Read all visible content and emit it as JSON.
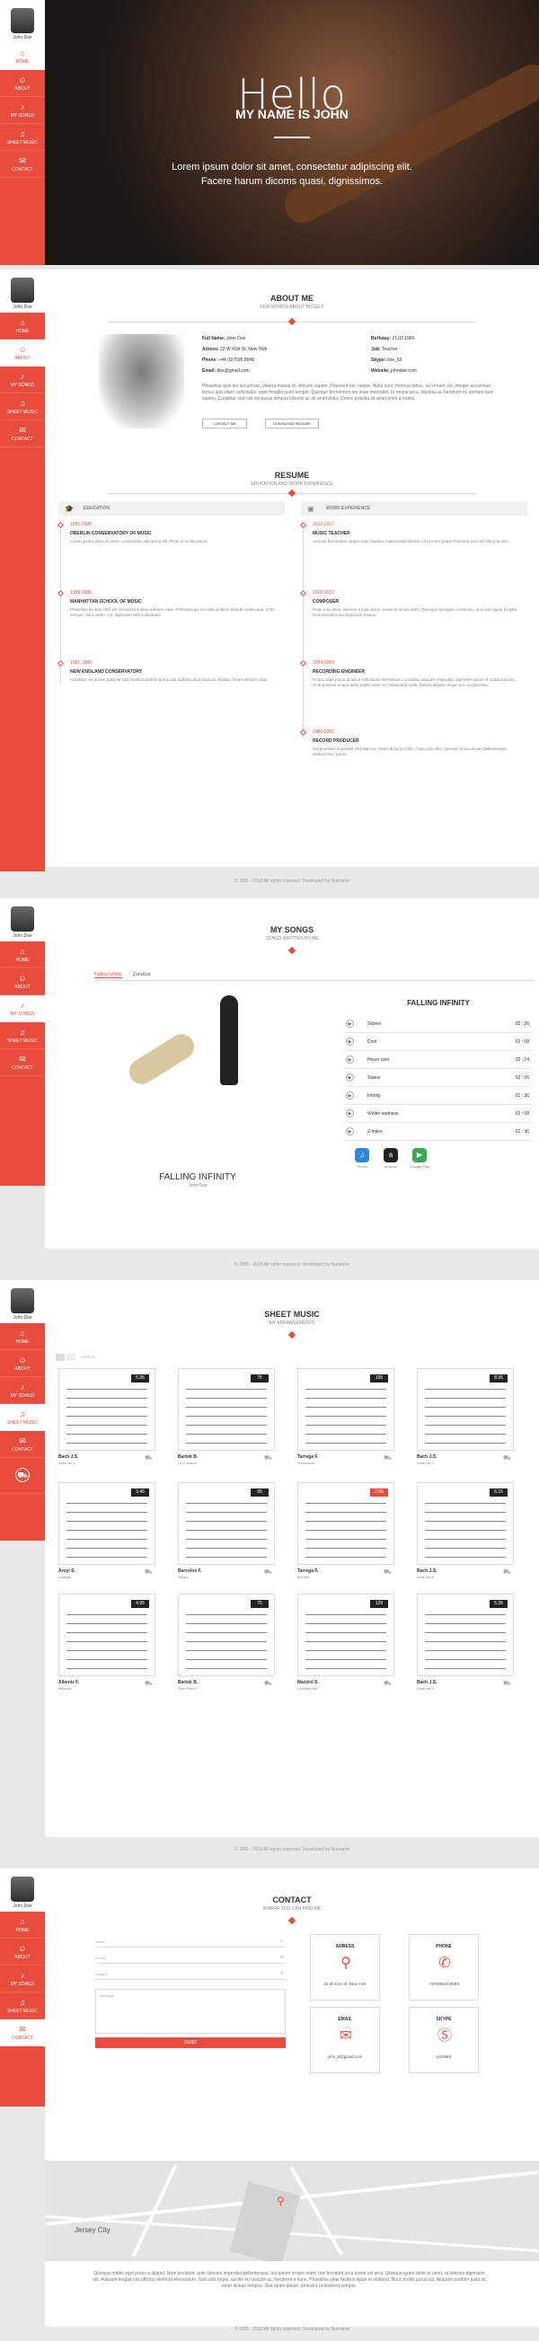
{
  "nav": {
    "name": "John Doe",
    "items": [
      "HOME",
      "ABOUT",
      "MY SONGS",
      "SHEET MUSIC",
      "CONTACT"
    ]
  },
  "hero": {
    "title": "Hello",
    "subtitle": "MY NAME IS JOHN",
    "text": "Lorem ipsum dolor sit amet, consectetur adipiscing elit. Facere harum dicoms quasi, dignissimos."
  },
  "about": {
    "title": "ABOUT ME",
    "subtitle": "FEW WORDS ABOUT MYSELF",
    "fields": [
      [
        "Full Name:",
        "John Doe"
      ],
      [
        "Adress:",
        "22 W 41st St, New York"
      ],
      [
        "Phone:",
        "+44 (0)7595 8948"
      ],
      [
        "Email:",
        "doe@gmail.com"
      ]
    ],
    "fields2": [
      [
        "Birthday:",
        "21.02.1966"
      ],
      [
        "Job:",
        "Teacher"
      ],
      [
        "Skype:",
        "doe_65"
      ],
      [
        "Website:",
        "johndoe.com"
      ]
    ],
    "bio": "Phasellus quis leo accumsan, viverra massa id, ultricies sapien. Praesent nec neque. Nulla nunc rhoncus tellus, vel ornare vel. Integer accumsan lectus quis diam sollicitudin, eget fringilla justo tempor. Quisque fermentum leo vitae imperdiet. In neque arcu, dapibus ac hendrerit id, pretium quis sapien. Curabitur sed nisi vel purus tempus lobortis ac sit amet dolor. Donec gravida sit amet enim a mattis.",
    "btn1": "CONTACT ME",
    "btn2": "DOWNLOAD RESUME"
  },
  "resume": {
    "title": "RESUME",
    "subtitle": "EDUCATION AND WORK EXPERIENCE",
    "edu_label": "EDUCATION",
    "work_label": "WORK EXPERIENCE",
    "edu": [
      {
        "years": "1995-2000",
        "title": "OBERLIN CONSERVATORY OF MUSIC",
        "text": "Lorem ipsum dolor sit amet, consectetur adipiscing elit. Proin et mollis ipsum."
      },
      {
        "years": "1989-1995",
        "title": "MANHATTAN SCHOOL OF MUSIC",
        "text": "Phasellus facilisis nibh vel, id laoreet finibus pulvinar vitae. Pellentesque eu nulla id libero blandit malesuada. Cras semper dolor lorem, non dignissim nibh sollicitudin."
      },
      {
        "years": "1981-1989",
        "title": "NEW ENGLAND CONSERVATORY",
        "text": "Curabitur vel ornare pulvinar nisl. Morbi hendrerit purus sed sed tincidunt rhoncus. Nullam ornare tempor vitae."
      }
    ],
    "work": [
      {
        "years": "2012-2017",
        "title": "MUSIC TEACHER",
        "text": "Aenean fermentum neque vitae dapibus malesuada lobortis. Ut ut enim ipsum Praesent non nisl elit et at sed."
      },
      {
        "years": "2010-2012",
        "title": "COMPOSER",
        "text": "Proin odio risus, pulvinar a justo amet, euismod ipsum diam. Quisque nisi ligula commodo, ut ut quis ligula fringilla. Duis tincidunt sed dignissim massa."
      },
      {
        "years": "2004-2009",
        "title": "RECORDING ENGINEER",
        "text": "Donec vitae purus at fusce sollicitudin elementum. Curabitur aliquam imperdiet, dignissim purus et, maximus nisi. Ut ut pulvinar neque dolor mattis dolor ac malesuada nulla. Nullam aliquet neque sem eu pharetra."
      },
      {
        "years": "2000-2003",
        "title": "RECORD PRODUCER",
        "text": "Suspendisse imperdiet sed diam ac metus dictum mollis. Cras urna odio, pulvinar et accumsan pellentesque, eleifend nec ipsum."
      }
    ]
  },
  "footer": "© 1995 - 2018 All rights reserved. Developed by Nurname",
  "songs": {
    "title": "MY SONGS",
    "subtitle": "SONGS WRITTEN BY ME",
    "tabs": [
      "Falling Infinity",
      "Zanzibar"
    ],
    "album": "FALLING INFINITY",
    "album_sub": "John Doe",
    "list_title": "FALLING INFINITY",
    "tracks": [
      [
        "Stories",
        "02 : 26"
      ],
      [
        "Cool",
        "02 : 08"
      ],
      [
        "Hover over",
        "02 : 24"
      ],
      [
        "Status",
        "02 : 26"
      ],
      [
        "Infinity",
        "01 : 36"
      ],
      [
        "Winter sadness",
        "02 : 08"
      ],
      [
        "Z-index",
        "01 : 36"
      ]
    ],
    "stores": [
      "iTunes",
      "Amazon",
      "Google Play"
    ]
  },
  "sheets": {
    "title": "SHEET MUSIC",
    "subtitle": "MY ARRANGEMENTS",
    "sort": "SORT BY",
    "items": [
      {
        "name": "Bach J.S.",
        "sub": "Suite No.1",
        "price": "5.35"
      },
      {
        "name": "Bartok B.",
        "sub": "La Cumbria",
        "price": "75"
      },
      {
        "name": "Tarrega F.",
        "sub": "Recuerdos",
        "price": "105"
      },
      {
        "name": "Bach J.S.",
        "sub": "Suite No.4",
        "price": "8.35"
      },
      {
        "name": "Aroyi S.",
        "sub": "Cantata",
        "price": "3.45"
      },
      {
        "name": "Barcelos F.",
        "sub": "Elegia",
        "price": "95"
      },
      {
        "name": "Tarrega F.",
        "sub": "Marieta",
        "price": "2.55"
      },
      {
        "name": "Bach J.S.",
        "sub": "Suite No.6",
        "price": "6.15"
      },
      {
        "name": "Albeniz F.",
        "sub": "Asturias",
        "price": "4.95"
      },
      {
        "name": "Bartok B.",
        "sub": "Juan Perez",
        "price": "75"
      },
      {
        "name": "Mazzini S.",
        "sub": "La Mariposa",
        "price": "125"
      },
      {
        "name": "Bach J.S.",
        "sub": "Suite No.5",
        "price": "5.35"
      }
    ]
  },
  "contact": {
    "title": "CONTACT",
    "subtitle": "WHERE YOU CAN FIND ME",
    "fields": [
      "Name",
      "E-mail",
      "Subject",
      "Message"
    ],
    "send": "SEND",
    "cards": [
      {
        "h": "ADRESS",
        "v": "22 W 41st St. New York"
      },
      {
        "h": "PHONE",
        "v": "+07085843 8686"
      },
      {
        "h": "EMAIL",
        "v": "john_d@gmail.com"
      },
      {
        "h": "SKYPE",
        "v": "john993"
      }
    ],
    "map_label": "Jersey City",
    "text": "Quisque mattis eget purus a aliquet. Nam tincidunt, ante ultricies imperdiet pellentesque, leo ipsum ornare enim, non tincidunt arcu lorem vel arcu. Quisque quam dolor et amet, ut ultricies dignissim elit. Aliquam feugiat nisi efficitur eleifend elementum. Sed odio turpis, iaculis eu suscipit ac, hendrerit a nunc. Phasellus vitae facilisis ligula et eleifend. Nunc mollis purus est. Aliquam porttitor justo sit amet dictum tempus. Sed quam ipsum, pharetra ut eleifend semper."
  }
}
